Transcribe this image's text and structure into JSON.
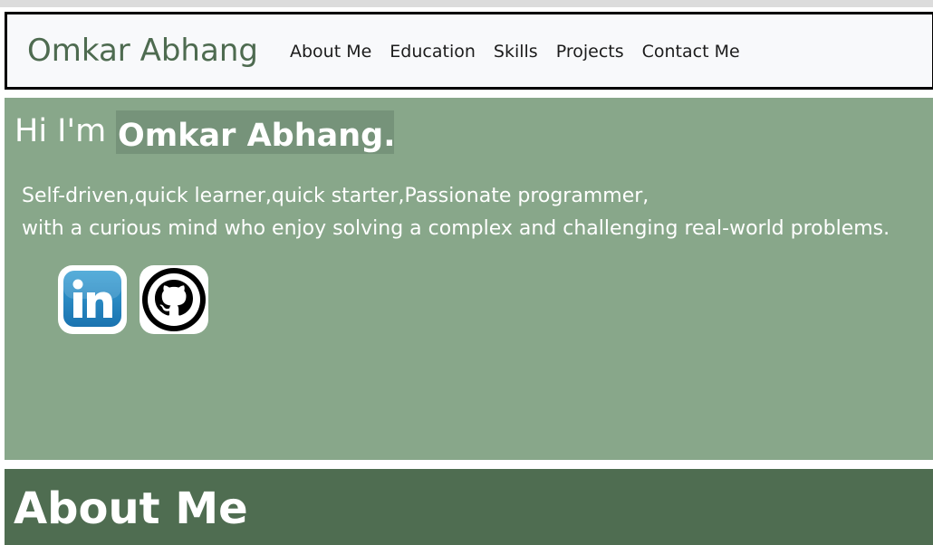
{
  "header": {
    "brand": "Omkar Abhang",
    "nav": [
      {
        "label": "About Me"
      },
      {
        "label": "Education"
      },
      {
        "label": "Skills"
      },
      {
        "label": "Projects"
      },
      {
        "label": "Contact Me"
      }
    ]
  },
  "hero": {
    "greeting": "Hi I'm",
    "name": "Omkar Abhang.",
    "description_line1": "Self-driven,quick learner,quick starter,Passionate programmer,",
    "description_line2": "with a curious mind who enjoy solving a complex and challenging real-world problems.",
    "social": [
      {
        "name": "linkedin-icon",
        "text": "in"
      },
      {
        "name": "github-icon"
      }
    ]
  },
  "about": {
    "title": "About Me"
  },
  "colors": {
    "brand_green": "#4e6b50",
    "hero_bg": "#88a78a",
    "about_bg": "#4f6d51"
  }
}
